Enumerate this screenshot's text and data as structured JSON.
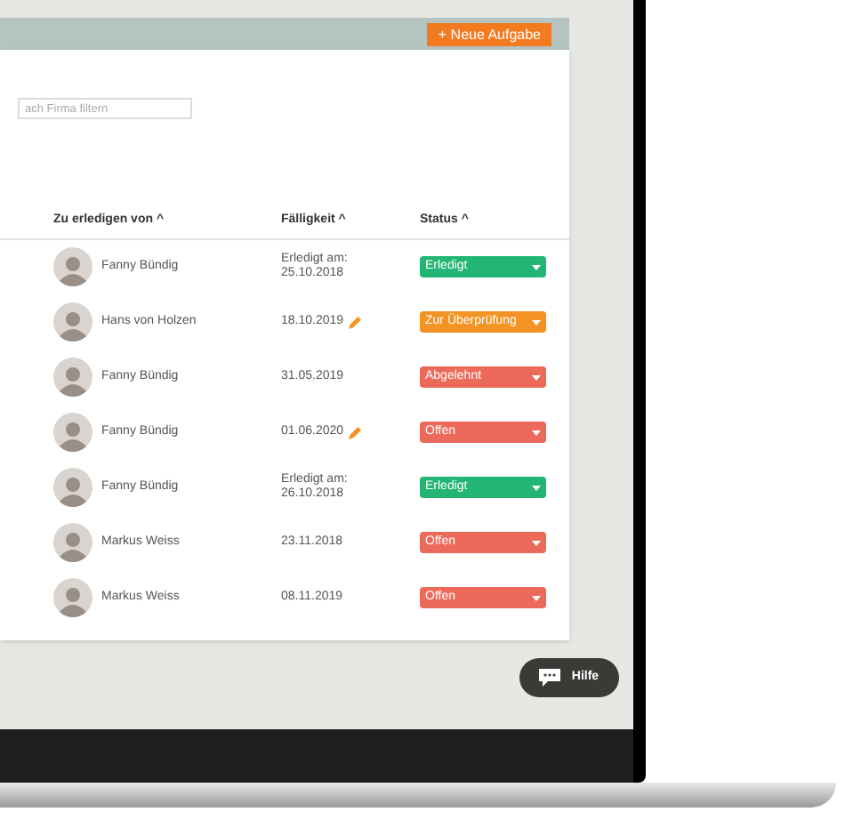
{
  "header": {
    "new_task_button": "+ Neue Aufgabe"
  },
  "filter": {
    "placeholder": "ach Firma filtern"
  },
  "table": {
    "columns": [
      "Zu erledigen von ^",
      "Fälligkeit ^",
      "Status ^"
    ],
    "rows": [
      {
        "assignee": "Fanny Bündig",
        "due": "Erledigt am:\n25.10.2018",
        "editable": false,
        "status": {
          "label": "Erledigt",
          "color": "#22b573"
        }
      },
      {
        "assignee": "Hans von Holzen",
        "due": "18.10.2019",
        "editable": true,
        "status": {
          "label": "Zur Überprüfung",
          "color": "#f39323"
        }
      },
      {
        "assignee": "Fanny Bündig",
        "due": "31.05.2019",
        "editable": false,
        "status": {
          "label": "Abgelehnt",
          "color": "#ec6a5a"
        }
      },
      {
        "assignee": "Fanny Bündig",
        "due": "01.06.2020",
        "editable": true,
        "status": {
          "label": "Offen",
          "color": "#ec6a5a"
        }
      },
      {
        "assignee": "Fanny Bündig",
        "due": "Erledigt am:\n26.10.2018",
        "editable": false,
        "status": {
          "label": "Erledigt",
          "color": "#22b573"
        }
      },
      {
        "assignee": "Markus Weiss",
        "due": "23.11.2018",
        "editable": false,
        "status": {
          "label": "Offen",
          "color": "#ec6a5a"
        }
      },
      {
        "assignee": "Markus Weiss",
        "due": "08.11.2019",
        "editable": false,
        "status": {
          "label": "Offen",
          "color": "#ec6a5a"
        }
      }
    ]
  },
  "help_button": "Hilfe"
}
